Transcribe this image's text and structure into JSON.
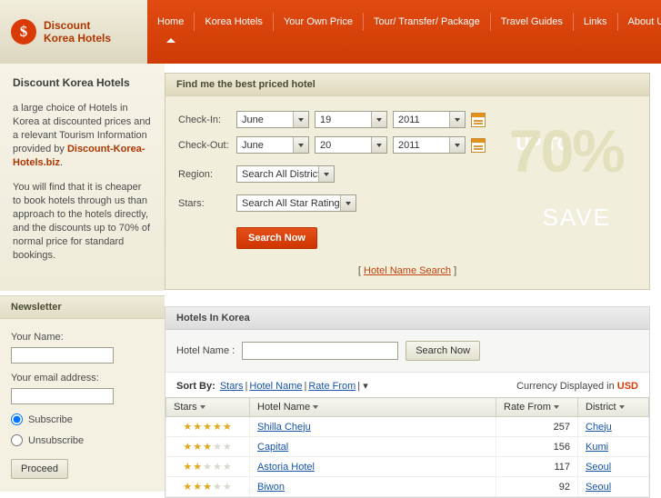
{
  "header": {
    "logo_initial": "$",
    "logo_line1": "Discount",
    "logo_line2": "Korea Hotels",
    "nav": [
      {
        "label": "Home",
        "active": true
      },
      {
        "label": "Korea Hotels",
        "active": false
      },
      {
        "label": "Your Own Price",
        "active": false
      },
      {
        "label": "Tour/ Transfer/ Package",
        "active": false
      },
      {
        "label": "Travel Guides",
        "active": false
      },
      {
        "label": "Links",
        "active": false
      },
      {
        "label": "About Us",
        "active": false
      }
    ]
  },
  "sidebar": {
    "intro_title": "Discount Korea Hotels",
    "intro_p1_before": "a large choice of Hotels in Korea at discounted prices and a relevant Tourism Information provided by ",
    "intro_p1_bold": "Discount-Korea-Hotels.biz",
    "intro_p1_after": ".",
    "intro_p2": "You will find that it is cheaper to book hotels through us than approach to the hotels directly, and the discounts up to 70% of normal price for standard bookings.",
    "newsletter_title": "Newsletter",
    "name_label": "Your Name:",
    "name_value": "",
    "email_label": "Your email address:",
    "email_value": "",
    "subscribe_label": "Subscribe",
    "unsubscribe_label": "Unsubscribe",
    "proceed_label": "Proceed"
  },
  "search": {
    "panel_title": "Find me the best priced hotel",
    "checkin_label": "Check-In:",
    "checkin_month": "June",
    "checkin_day": "19",
    "checkin_year": "2011",
    "checkout_label": "Check-Out:",
    "checkout_month": "June",
    "checkout_day": "20",
    "checkout_year": "2011",
    "region_label": "Region:",
    "region_value": "Search All District",
    "stars_label": "Stars:",
    "stars_value": "Search All Star Ratings",
    "search_button": "Search Now",
    "alt_search_prefix": "[",
    "alt_search_link": "Hotel Name Search",
    "alt_search_suffix": "]",
    "watermark_percent": "70%",
    "watermark_upto": "UP TO",
    "watermark_save": "SAVE"
  },
  "hotels": {
    "panel_title": "Hotels In Korea",
    "hotel_name_label": "Hotel Name :",
    "hotel_name_value": "",
    "hotel_name_search_button": "Search Now",
    "sort_by_label": "Sort By:",
    "sort_options": [
      "Stars",
      "Hotel Name",
      "Rate From"
    ],
    "currency_label": "Currency Displayed in",
    "currency_value": "USD",
    "columns": [
      "Stars",
      "Hotel Name",
      "Rate From",
      "District"
    ],
    "rows": [
      {
        "stars": 5,
        "name": "Shilla Cheju",
        "rate": "257",
        "district": "Cheju"
      },
      {
        "stars": 3,
        "name": "Capital",
        "rate": "156",
        "district": "Kumi"
      },
      {
        "stars": 2,
        "name": "Astoria Hotel",
        "rate": "117",
        "district": "Seoul"
      },
      {
        "stars": 3,
        "name": "Biwon",
        "rate": "92",
        "district": "Seoul"
      }
    ]
  }
}
